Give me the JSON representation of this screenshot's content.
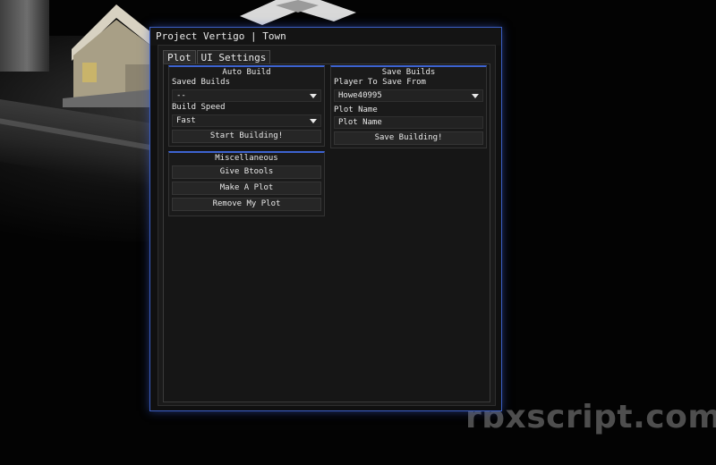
{
  "window": {
    "title": "Project Vertigo | Town"
  },
  "tabs": [
    {
      "label": "Plot",
      "active": true
    },
    {
      "label": "UI Settings",
      "active": false
    }
  ],
  "auto_build": {
    "title": "Auto Build",
    "saved_builds_label": "Saved Builds",
    "saved_builds_value": "--",
    "build_speed_label": "Build Speed",
    "build_speed_value": "Fast",
    "start_button": "Start Building!"
  },
  "save_builds": {
    "title": "Save Builds",
    "player_label": "Player To Save From",
    "player_value": "Howe40995",
    "plot_name_label": "Plot Name",
    "plot_name_placeholder": "Plot Name",
    "save_button": "Save Building!"
  },
  "misc": {
    "title": "Miscellaneous",
    "buttons": [
      "Give Btools",
      "Make A Plot",
      "Remove My Plot"
    ]
  },
  "watermark": "rbxscript.com",
  "colors": {
    "accent": "#3d63d0",
    "window_border": "#3a5ec4"
  }
}
